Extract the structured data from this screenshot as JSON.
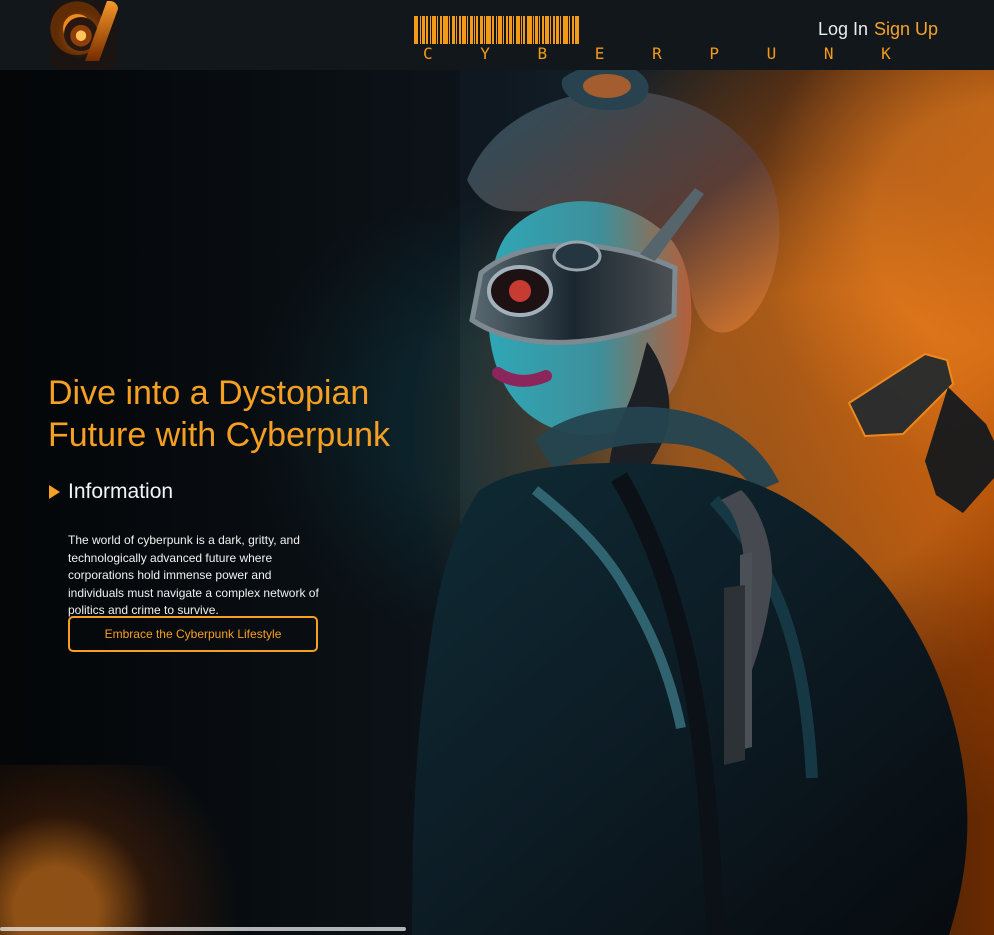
{
  "header": {
    "brand_text": "C Y B E R   P U N K",
    "login_label": "Log In",
    "signup_label": "Sign Up"
  },
  "hero": {
    "title": "Dive into a Dystopian Future with Cyberpunk",
    "section_label": "Information",
    "description": "The world of cyberpunk is a dark, gritty, and technologically advanced future where corporations hold immense power and individuals must navigate a complex network of politics and crime to survive.",
    "cta_label": "Embrace the Cyberpunk Lifestyle"
  },
  "colors": {
    "accent": "#f5a022",
    "header_bg": "#12171c",
    "page_bg": "#0b0f13"
  },
  "icons": {
    "play": "play-icon",
    "logo": "cyberpunk-logo-icon",
    "barcode": "barcode-logo-icon"
  }
}
